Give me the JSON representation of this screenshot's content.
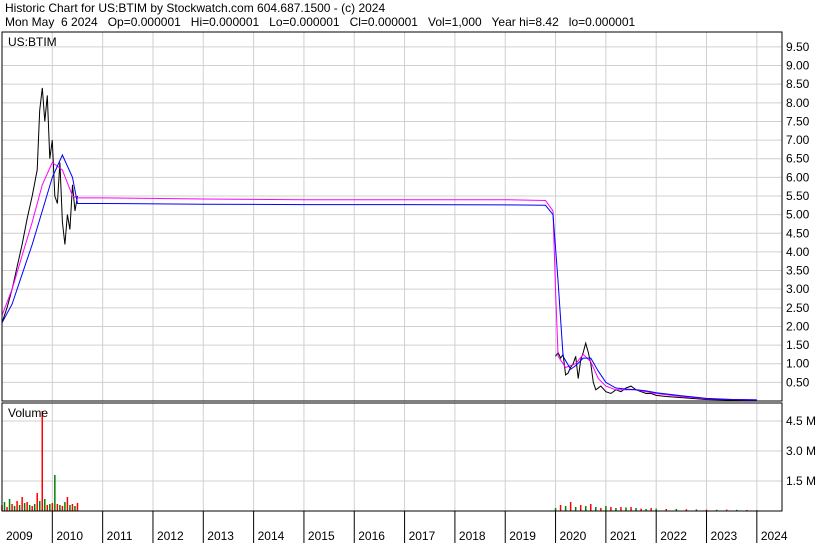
{
  "header": {
    "line1": "Historic Chart for US:BTIM by Stockwatch.com 604.687.1500 - (c) 2024",
    "line2": "Mon May  6 2024   Op=0.000001   Hi=0.000001   Lo=0.000001   Cl=0.000001   Vol=1,000   Year hi=8.42   lo=0.000001"
  },
  "chart_data": [
    {
      "type": "line",
      "panel": "price",
      "label": "US:BTIM",
      "ylim": [
        0,
        9.9
      ],
      "y_ticks": [
        "0.50",
        "1.00",
        "1.50",
        "2.00",
        "2.50",
        "3.00",
        "3.50",
        "4.00",
        "4.50",
        "5.00",
        "5.50",
        "6.00",
        "6.50",
        "7.00",
        "7.50",
        "8.00",
        "8.50",
        "9.00",
        "9.50"
      ],
      "grid": true,
      "x_ticks": [
        "2009",
        "2010",
        "2011",
        "2012",
        "2013",
        "2014",
        "2015",
        "2016",
        "2017",
        "2018",
        "2019",
        "2020",
        "2021",
        "2022",
        "2023",
        "2024"
      ],
      "series": [
        {
          "color": "#000000",
          "x": [
            2009.0,
            2009.1,
            2009.2,
            2009.3,
            2009.4,
            2009.5,
            2009.6,
            2009.7,
            2009.75,
            2009.8,
            2009.85,
            2009.9,
            2009.95,
            2010.0,
            2010.05,
            2010.1,
            2010.15,
            2010.2,
            2010.25,
            2010.3,
            2010.35,
            2010.4,
            2010.45,
            2010.5
          ],
          "y": [
            2.1,
            2.5,
            3.0,
            3.6,
            4.2,
            4.9,
            5.5,
            6.2,
            7.8,
            8.4,
            7.5,
            8.2,
            6.5,
            7.0,
            5.5,
            5.3,
            6.4,
            4.8,
            4.2,
            5.0,
            4.6,
            5.8,
            5.1,
            5.5
          ]
        },
        {
          "color": "#000000",
          "x": [
            2020.0,
            2020.05,
            2020.1,
            2020.15,
            2020.2,
            2020.25,
            2020.3,
            2020.35,
            2020.4,
            2020.45,
            2020.5,
            2020.55,
            2020.6,
            2020.65,
            2020.7,
            2020.75,
            2020.8,
            2020.9,
            2021.0,
            2021.1,
            2021.2,
            2021.3,
            2021.4,
            2021.5,
            2021.6,
            2021.7,
            2021.8,
            2021.9,
            2022.0,
            2022.2,
            2022.4,
            2022.6,
            2022.8,
            2023.0,
            2023.3,
            2023.6,
            2024.0
          ],
          "y": [
            1.2,
            1.3,
            1.15,
            1.25,
            0.7,
            0.75,
            0.9,
            1.0,
            1.2,
            0.6,
            1.1,
            1.3,
            1.55,
            1.3,
            1.0,
            0.5,
            0.3,
            0.4,
            0.25,
            0.2,
            0.3,
            0.25,
            0.35,
            0.4,
            0.3,
            0.25,
            0.2,
            0.2,
            0.15,
            0.12,
            0.1,
            0.08,
            0.06,
            0.04,
            0.03,
            0.02,
            0.01
          ]
        },
        {
          "color": "#ff00ff",
          "x": [
            2009.0,
            2009.2,
            2009.4,
            2009.6,
            2009.8,
            2010.0,
            2010.2,
            2010.4,
            2010.5,
            2011.0,
            2013.0,
            2015.0,
            2017.0,
            2019.0,
            2019.8,
            2019.95,
            2020.0,
            2020.05,
            2020.2,
            2020.4,
            2020.55,
            2020.7,
            2020.85,
            2021.0,
            2021.2,
            2021.4,
            2021.6,
            2021.8,
            2022.0,
            2022.5,
            2023.0,
            2023.5,
            2024.0
          ],
          "y": [
            2.3,
            3.0,
            3.9,
            4.8,
            5.8,
            6.4,
            6.2,
            5.5,
            5.45,
            5.45,
            5.42,
            5.4,
            5.4,
            5.4,
            5.38,
            5.1,
            3.0,
            1.2,
            0.9,
            1.0,
            1.25,
            1.05,
            0.6,
            0.4,
            0.3,
            0.3,
            0.3,
            0.25,
            0.2,
            0.12,
            0.06,
            0.04,
            0.03
          ]
        },
        {
          "color": "#0000ff",
          "x": [
            2009.0,
            2009.2,
            2009.4,
            2009.6,
            2009.8,
            2010.0,
            2010.2,
            2010.4,
            2010.5,
            2011.0,
            2013.0,
            2015.0,
            2017.0,
            2019.0,
            2019.8,
            2019.95,
            2020.05,
            2020.15,
            2020.3,
            2020.4,
            2020.55,
            2020.7,
            2020.85,
            2021.0,
            2021.2,
            2021.4,
            2021.6,
            2021.8,
            2022.0,
            2022.5,
            2023.0,
            2023.5,
            2024.0
          ],
          "y": [
            2.1,
            2.6,
            3.4,
            4.2,
            5.1,
            6.0,
            6.6,
            6.0,
            5.3,
            5.3,
            5.28,
            5.27,
            5.27,
            5.26,
            5.25,
            5.0,
            3.2,
            1.2,
            0.85,
            0.95,
            1.15,
            1.15,
            0.8,
            0.5,
            0.35,
            0.32,
            0.3,
            0.27,
            0.22,
            0.14,
            0.07,
            0.04,
            0.03
          ]
        }
      ]
    },
    {
      "type": "bar",
      "panel": "volume",
      "label": "Volume",
      "ylim": [
        0,
        5400000
      ],
      "y_ticks": [
        "1.5 M",
        "3.0 M",
        "4.5 M"
      ],
      "grid": true,
      "x_ticks": [
        "2009",
        "2010",
        "2011",
        "2012",
        "2013",
        "2014",
        "2015",
        "2016",
        "2017",
        "2018",
        "2019",
        "2020",
        "2021",
        "2022",
        "2023",
        "2024"
      ],
      "x": [
        2009.0,
        2009.05,
        2009.1,
        2009.15,
        2009.2,
        2009.25,
        2009.3,
        2009.35,
        2009.4,
        2009.45,
        2009.5,
        2009.55,
        2009.6,
        2009.65,
        2009.7,
        2009.75,
        2009.8,
        2009.85,
        2009.9,
        2009.95,
        2010.0,
        2010.05,
        2010.1,
        2010.15,
        2010.2,
        2010.25,
        2010.3,
        2010.35,
        2010.4,
        2010.45,
        2010.5,
        2020.0,
        2020.1,
        2020.2,
        2020.3,
        2020.4,
        2020.5,
        2020.6,
        2020.7,
        2020.8,
        2020.9,
        2021.0,
        2021.1,
        2021.2,
        2021.3,
        2021.4,
        2021.5,
        2021.6,
        2021.7,
        2021.8,
        2021.9,
        2022.0,
        2022.2,
        2022.4,
        2022.6,
        2022.8,
        2023.0,
        2023.2,
        2023.4,
        2023.6,
        2023.8,
        2024.0
      ],
      "values": [
        300000,
        450000,
        200000,
        600000,
        350000,
        250000,
        500000,
        300000,
        700000,
        400000,
        450000,
        300000,
        250000,
        350000,
        900000,
        500000,
        5000000,
        600000,
        300000,
        350000,
        400000,
        1800000,
        350000,
        300000,
        250000,
        450000,
        700000,
        300000,
        350000,
        250000,
        400000,
        150000,
        300000,
        250000,
        450000,
        200000,
        300000,
        250000,
        350000,
        200000,
        150000,
        250000,
        200000,
        150000,
        200000,
        180000,
        200000,
        150000,
        120000,
        100000,
        150000,
        120000,
        100000,
        100000,
        90000,
        80000,
        70000,
        60000,
        70000,
        60000,
        50000,
        40000
      ],
      "bar_colors": [
        "#ff0000",
        "#008000"
      ]
    }
  ]
}
